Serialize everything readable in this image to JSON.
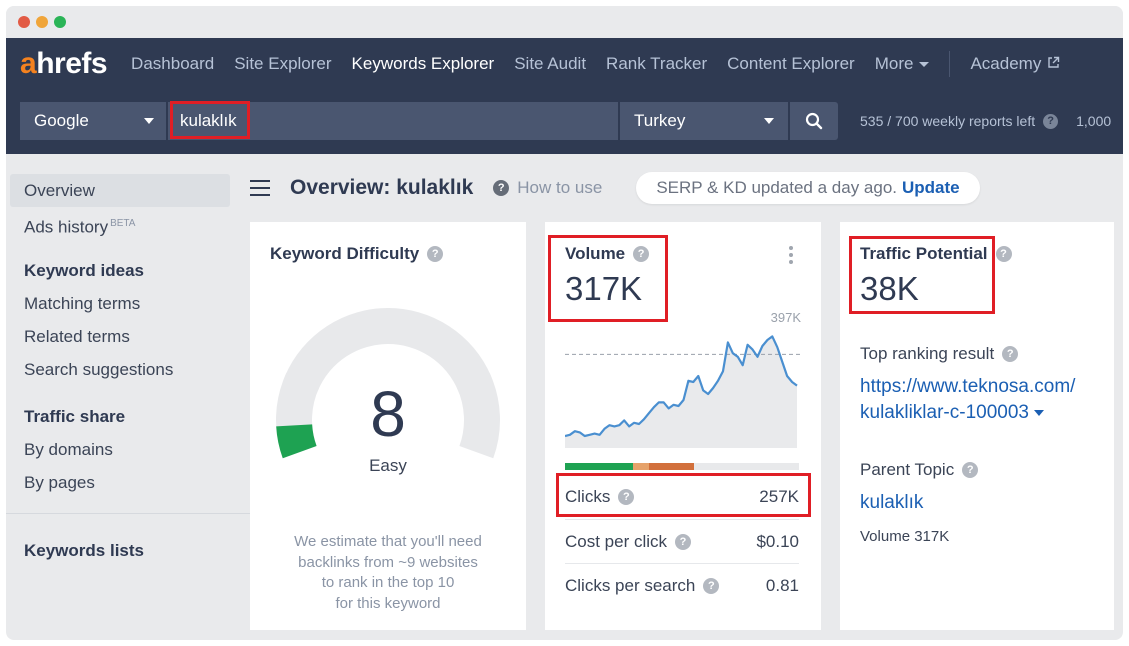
{
  "window": {
    "traffic_lights": [
      "#e25b45",
      "#f0a53a",
      "#2ab457"
    ]
  },
  "nav": {
    "logo_a": "a",
    "logo_rest": "hrefs",
    "links": [
      {
        "label": "Dashboard",
        "active": false
      },
      {
        "label": "Site Explorer",
        "active": false
      },
      {
        "label": "Keywords Explorer",
        "active": true
      },
      {
        "label": "Site Audit",
        "active": false
      },
      {
        "label": "Rank Tracker",
        "active": false
      },
      {
        "label": "Content Explorer",
        "active": false
      }
    ],
    "more_label": "More",
    "academy_label": "Academy",
    "academy_icon": "external-link-icon"
  },
  "search": {
    "engine": "Google",
    "keyword": "kulaklık",
    "country": "Turkey",
    "search_icon": "search-icon",
    "reports_left": "535 / 700 weekly reports left",
    "credits_partial": "1,000"
  },
  "sidebar": {
    "overview": "Overview",
    "ads_history": "Ads history",
    "ads_badge": "BETA",
    "keyword_ideas_heading": "Keyword ideas",
    "keyword_ideas": [
      "Matching terms",
      "Related terms",
      "Search suggestions"
    ],
    "traffic_share_heading": "Traffic share",
    "traffic_share": [
      "By domains",
      "By pages"
    ],
    "keywords_lists_heading": "Keywords lists"
  },
  "header": {
    "title": "Overview: kulaklık",
    "how_to_use": "How to use",
    "update_text": "SERP & KD updated a day ago.",
    "update_link": "Update"
  },
  "kd_card": {
    "title": "Keyword Difficulty",
    "score": "8",
    "score_value": 8,
    "score_max": 100,
    "label": "Easy",
    "description_lines": [
      "We estimate that you'll need",
      "backlinks from ~9 websites",
      "to rank in the top 10",
      "for this keyword"
    ],
    "fill_color": "#1ea252",
    "track_color": "#e8e9eb"
  },
  "volume_card": {
    "title": "Volume",
    "value": "317K",
    "chart_max_label": "397K",
    "trend_series": [
      0.1,
      0.11,
      0.14,
      0.13,
      0.1,
      0.11,
      0.12,
      0.11,
      0.16,
      0.19,
      0.18,
      0.19,
      0.23,
      0.18,
      0.21,
      0.2,
      0.24,
      0.29,
      0.34,
      0.38,
      0.38,
      0.33,
      0.36,
      0.35,
      0.4,
      0.56,
      0.55,
      0.6,
      0.48,
      0.45,
      0.5,
      0.56,
      0.64,
      0.88,
      0.79,
      0.76,
      0.69,
      0.86,
      0.82,
      0.76,
      0.85,
      0.9,
      0.93,
      0.84,
      0.72,
      0.6,
      0.55,
      0.52
    ],
    "reference_line_fraction": 0.78,
    "clicks_bar": [
      {
        "kind": "organic",
        "fraction": 0.29,
        "color": "#1ea252"
      },
      {
        "kind": "organic-paid",
        "fraction": 0.07,
        "color": "#e6a26a"
      },
      {
        "kind": "paid",
        "fraction": 0.19,
        "color": "#d2703c"
      },
      {
        "kind": "no-clicks",
        "fraction": 0.45,
        "color": "#e8e9eb"
      }
    ],
    "metrics": [
      {
        "label": "Clicks",
        "value": "257K"
      },
      {
        "label": "Cost per click",
        "value": "$0.10"
      },
      {
        "label": "Clicks per search",
        "value": "0.81"
      }
    ]
  },
  "tp_card": {
    "title": "Traffic Potential",
    "value": "38K",
    "top_ranking_label": "Top ranking result",
    "top_ranking_url_line1": "https://www.teknosa.com/",
    "top_ranking_url_line2": "kulakliklar-c-100003",
    "parent_topic_label": "Parent Topic",
    "parent_topic": "kulaklık",
    "parent_volume": "Volume 317K"
  },
  "accent": {
    "nav_bg": "#2f3a52",
    "link": "#1b5fb3",
    "highlight_box": "#e01e25"
  }
}
